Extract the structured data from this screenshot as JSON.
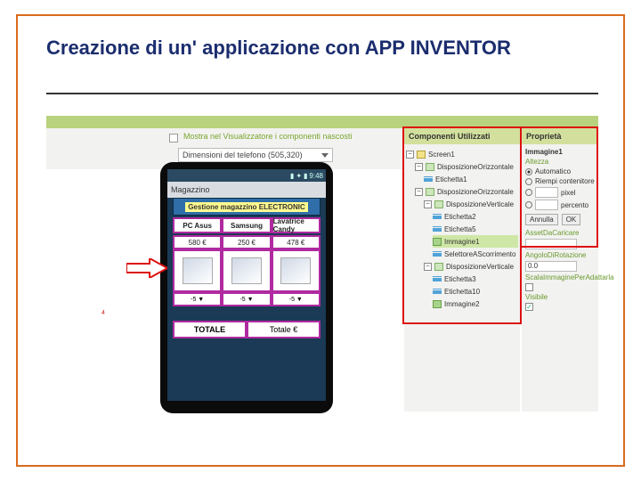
{
  "slide": {
    "title": "Creazione di un' applicazione con APP INVENTOR",
    "note_char": "4"
  },
  "toolbar": {
    "show_hidden_label": "Mostra nel Visualizzatore i componenti nascosti",
    "dimensions_label": "Dimensioni del telefono (505,320)"
  },
  "statusbar": {
    "time": "9:48"
  },
  "app": {
    "actionbar_title": "Magazzino",
    "banner": "Gestione magazzino ELECTRONIC",
    "headers": [
      "PC Asus",
      "Samsung",
      "Lavatrice Candy"
    ],
    "prices": [
      "580 €",
      "250 €",
      "478 €"
    ],
    "spinner": "-5 ▼",
    "total_label": "TOTALE",
    "total_value": "Totale €"
  },
  "components": {
    "header": "Componenti Utilizzati",
    "tree": {
      "screen": "Screen1",
      "h1": "DisposizioneOrizzontale",
      "e1": "Etichetta1",
      "h2": "DisposizioneOrizzontale",
      "h3": "DisposizioneVerticale",
      "e2": "Etichetta2",
      "e5": "Etichetta5",
      "img1": "Immagine1",
      "sel1": "SelettoreAScorrimento",
      "h4": "DisposizioneVerticale",
      "e3": "Etichetta3",
      "e10": "Etichetta10",
      "img2": "Immagine2"
    }
  },
  "properties": {
    "header": "Proprietà",
    "item": "Immagine1",
    "height_label": "Altezza",
    "auto": "Automatico",
    "fill": "Riempi contenitore",
    "pixel": "pixel",
    "percent": "percento",
    "cancel": "Annulla",
    "ok": "OK",
    "asset_label": "AssetDaCaricare",
    "rotation_label": "AngoloDiRotazione",
    "rotation_val": "0.0",
    "scale_label": "ScalaImmaginePerAdattarla",
    "visible_label": "Visibile"
  }
}
